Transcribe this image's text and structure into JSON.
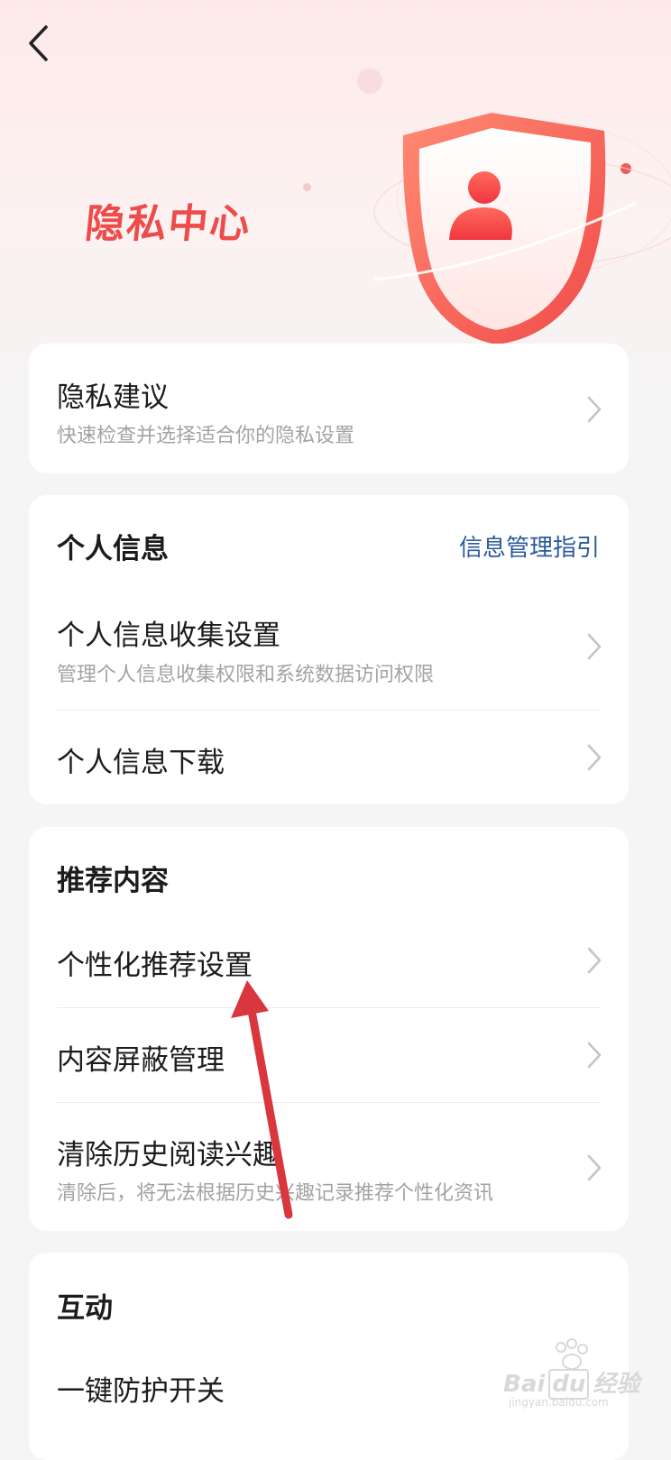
{
  "header": {
    "title": "隐私中心"
  },
  "privacy_suggestion": {
    "title": "隐私建议",
    "subtitle": "快速检查并选择适合你的隐私设置"
  },
  "personal_info": {
    "section_title": "个人信息",
    "guide_link": "信息管理指引",
    "items": [
      {
        "title": "个人信息收集设置",
        "subtitle": "管理个人信息收集权限和系统数据访问权限"
      },
      {
        "title": "个人信息下载"
      }
    ]
  },
  "recommend": {
    "section_title": "推荐内容",
    "items": [
      {
        "title": "个性化推荐设置"
      },
      {
        "title": "内容屏蔽管理"
      },
      {
        "title": "清除历史阅读兴趣",
        "subtitle": "清除后，将无法根据历史兴趣记录推荐个性化资讯"
      }
    ]
  },
  "interaction": {
    "section_title": "互动",
    "items": [
      {
        "title": "一键防护开关"
      }
    ]
  },
  "watermark": {
    "brand": "Bai",
    "brand_suffix": "du",
    "cn": "经验",
    "url": "jingyan.baidu.com"
  },
  "colors": {
    "accent_red": "#ee4b4b",
    "link_blue": "#2a5a9c",
    "annotation_arrow": "#d9363e"
  }
}
